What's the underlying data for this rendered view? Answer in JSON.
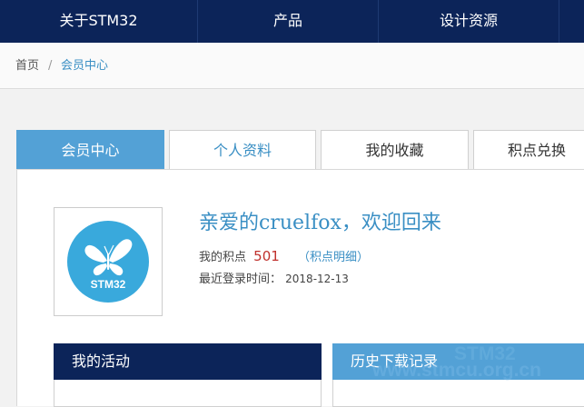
{
  "nav": {
    "items": [
      {
        "label": "关于STM32"
      },
      {
        "label": "产品"
      },
      {
        "label": "设计资源"
      },
      {
        "label": ""
      }
    ]
  },
  "breadcrumb": {
    "home": "首页",
    "separator": "/",
    "current": "会员中心"
  },
  "tabs": [
    {
      "label": "会员中心",
      "active": true
    },
    {
      "label": "个人资料",
      "active": false
    },
    {
      "label": "我的收藏",
      "active": false
    },
    {
      "label": "积点兑换",
      "active": false
    }
  ],
  "profile": {
    "avatar_text": "STM32",
    "welcome": "亲爱的cruelfox，欢迎回来",
    "points_label": "我的积点",
    "points_value": "501",
    "points_link": "（积点明细）",
    "last_login_label": "最近登录时间：",
    "last_login_date": "2018-12-13"
  },
  "sections": {
    "activity_title": "我的活动",
    "history_title": "历史下载记录"
  },
  "watermark": {
    "text": "www.stmcu.org.cn",
    "logo_text": "STM32"
  },
  "colors": {
    "nav_bg": "#0c2459",
    "accent": "#53a1d6",
    "link": "#3a8fc4",
    "points": "#c0312d",
    "avatar": "#39a9dc"
  }
}
